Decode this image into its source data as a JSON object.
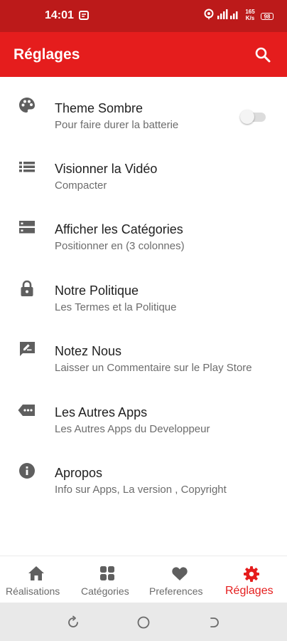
{
  "status_bar": {
    "time": "14:01",
    "network_speed_value": "165",
    "network_speed_unit": "K/s",
    "battery_level": "98"
  },
  "app_bar": {
    "title": "Réglages",
    "icon": "search-icon"
  },
  "settings_items": [
    {
      "title": "Theme Sombre",
      "subtitle": "Pour faire durer la batterie",
      "icon": "palette-icon",
      "toggle_on": false
    },
    {
      "title": "Visionner la Vidéo",
      "subtitle": "Compacter",
      "icon": "list-icon"
    },
    {
      "title": "Afficher les Catégories",
      "subtitle": "Positionner en (3 colonnes)",
      "icon": "storage-icon"
    },
    {
      "title": "Notre Politique",
      "subtitle": "Les Termes et la Politique",
      "icon": "lock-icon"
    },
    {
      "title": "Notez Nous",
      "subtitle": "Laisser un Commentaire sur le Play Store",
      "icon": "rate-review-icon"
    },
    {
      "title": "Les Autres Apps",
      "subtitle": "Les Autres Apps du Developpeur",
      "icon": "more-apps-icon"
    },
    {
      "title": "Apropos",
      "subtitle": "Info sur Apps, La version , Copyright",
      "icon": "info-icon"
    }
  ],
  "bottom_nav": [
    {
      "label": "Réalisations",
      "icon": "home-icon",
      "active": false
    },
    {
      "label": "Catégories",
      "icon": "grid-icon",
      "active": false
    },
    {
      "label": "Preferences",
      "icon": "heart-icon",
      "active": false
    },
    {
      "label": "Réglages",
      "icon": "gear-icon",
      "active": true
    }
  ],
  "colors": {
    "status_bar": "#bc1a1a",
    "primary": "#e51d1d",
    "icon_gray": "#5f5f5f",
    "system_nav": "#e9e9e9"
  }
}
